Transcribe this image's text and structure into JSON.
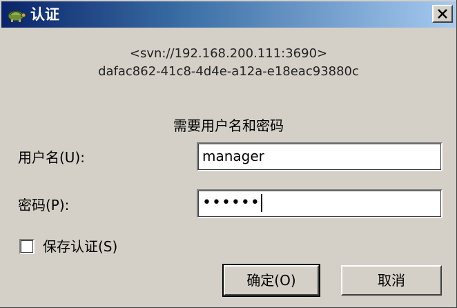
{
  "window": {
    "title": "认证",
    "icon": "tortoise-icon"
  },
  "realm": {
    "line1": "<svn://192.168.200.111:3690>",
    "line2": "dafac862-41c8-4d4e-a12a-e18eac93880c"
  },
  "prompt": "需要用户名和密码",
  "form": {
    "username_label": "用户名(U):",
    "username_value": "manager",
    "password_label": "密码(P):",
    "password_value": "••••••",
    "save_label": "保存认证(S)",
    "save_checked": false
  },
  "buttons": {
    "ok": "确定(O)",
    "cancel": "取消"
  },
  "colors": {
    "face": "#d4d0c8",
    "title_start": "#0a246a",
    "title_end": "#a6caf0"
  }
}
